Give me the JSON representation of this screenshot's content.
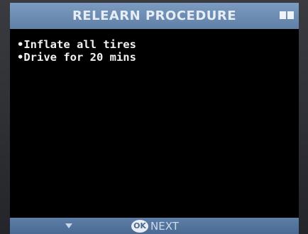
{
  "header": {
    "title": "RELEARN PROCEDURE",
    "battery_icon": "battery-icon"
  },
  "content": {
    "lines": [
      "•Inflate all tires",
      "•Drive for 20 mins"
    ]
  },
  "footer": {
    "down_icon": "down-arrow-icon",
    "ok_label": "OK",
    "next_label": "NEXT"
  },
  "colors": {
    "header_blue": "#6f8fb6",
    "screen_bg": "#000000",
    "text": "#f2f2f2"
  }
}
